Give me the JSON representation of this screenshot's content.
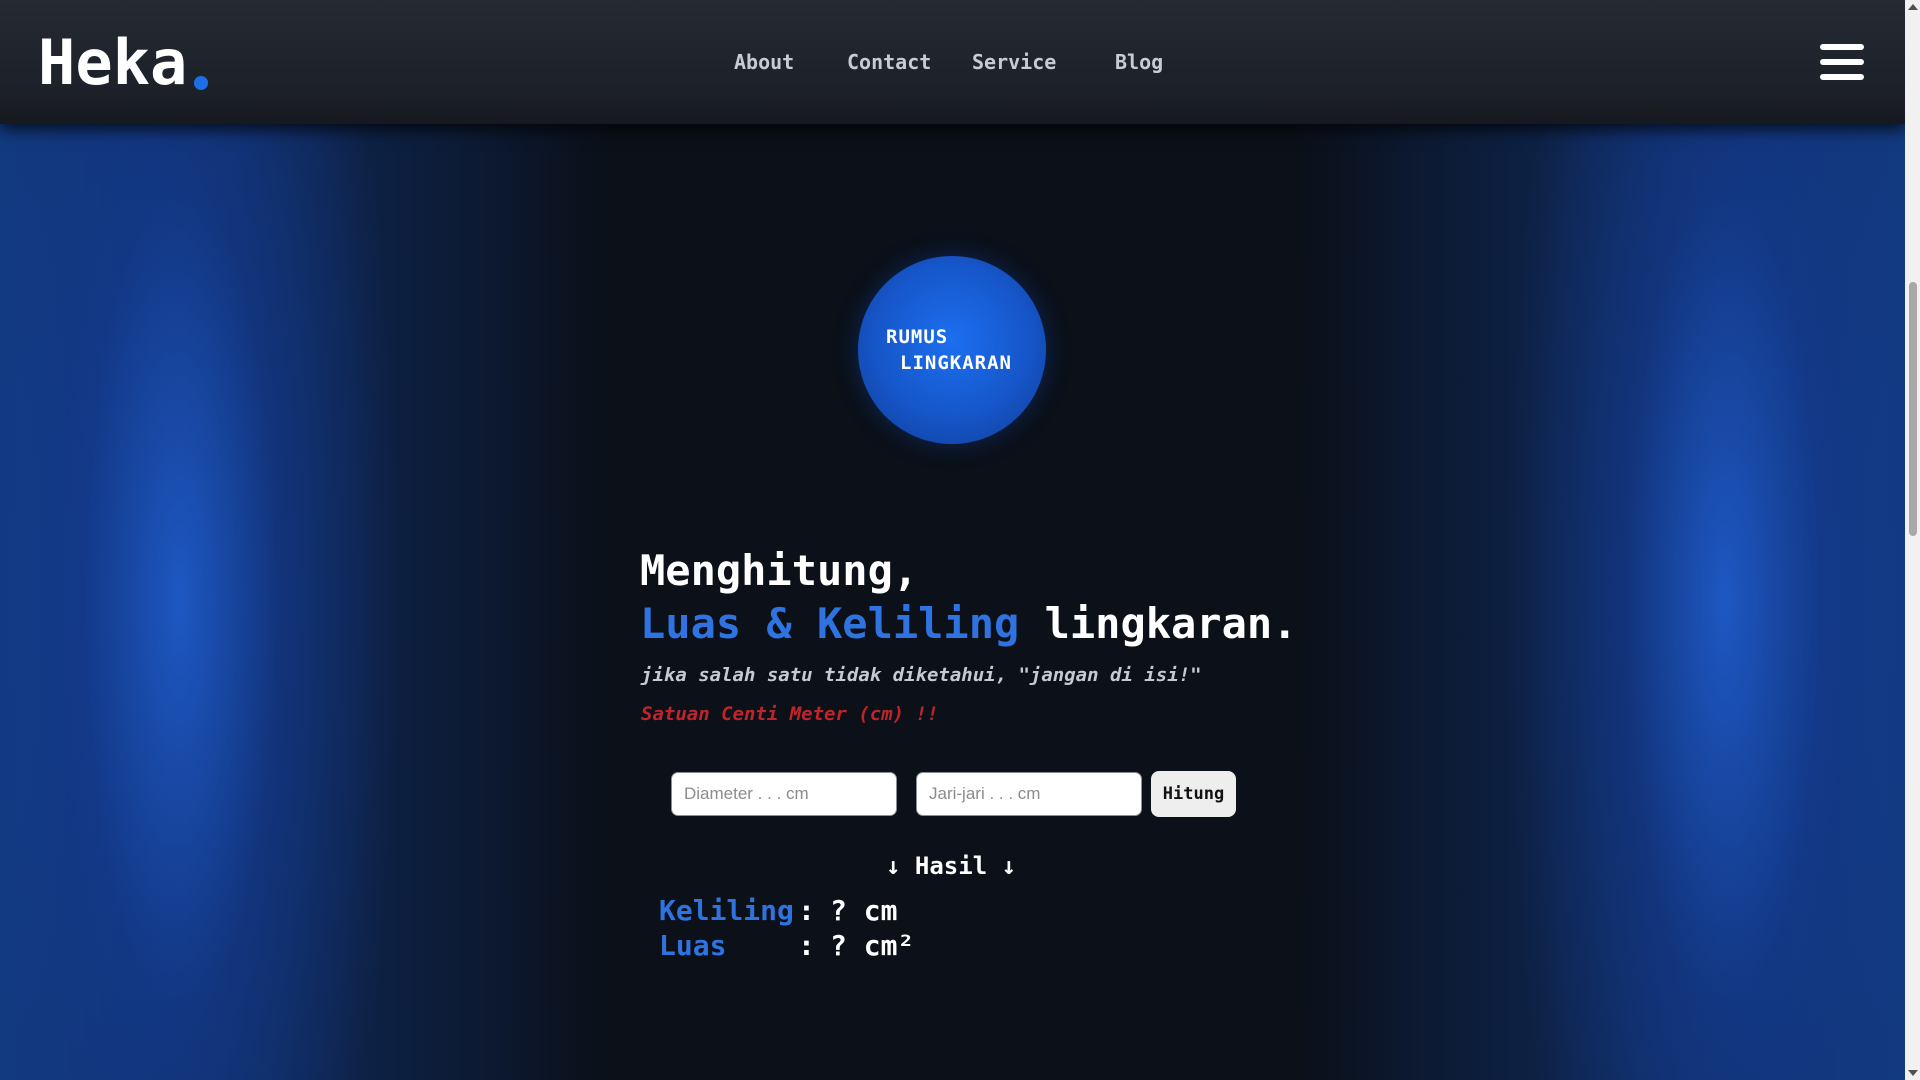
{
  "header": {
    "logo": "Heka",
    "logo_dot_color": "#1e6ee8",
    "nav": [
      "About",
      "Contact",
      "Service",
      "Blog"
    ],
    "menu_icon": "hamburger-menu-icon"
  },
  "badge": {
    "line1": "RUMUS",
    "line2": "LINGKARAN"
  },
  "hero": {
    "line1": "Menghitung,",
    "line2_blue": "Luas & Keliling",
    "line2_white": " lingkaran.",
    "note": "jika salah satu tidak diketahui, \"jangan di isi!\"",
    "warning": "Satuan Centi Meter (cm) !!"
  },
  "form": {
    "diameter_placeholder": "Diameter . . . cm",
    "diameter_value": "",
    "radius_placeholder": "Jari-jari . . . cm",
    "radius_value": "",
    "button_label": "Hitung"
  },
  "result": {
    "heading": "↓ Hasil ↓",
    "keliling_label": "Keliling",
    "keliling_value": "? cm",
    "luas_label": "Luas",
    "luas_value": "? cm²",
    "separator": ":"
  },
  "colors": {
    "accent_blue": "#2f73e0",
    "warning_red": "#c0242a",
    "note_gray": "#c5c9d0"
  }
}
